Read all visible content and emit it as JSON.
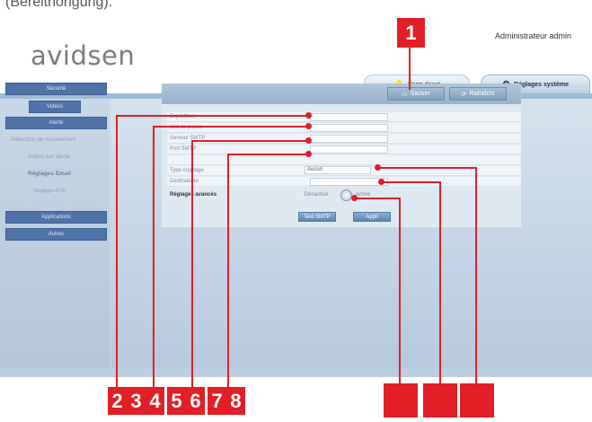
{
  "caption": "(Bereitnorigung).",
  "app": {
    "logo": "avidsen",
    "user": "Administrateur admin",
    "tabs": {
      "alert": "alarm deset",
      "system": "Réglages système"
    }
  },
  "sidebar": {
    "items": [
      {
        "label": "Sécurité",
        "style": "button"
      },
      {
        "label": "Vidéos",
        "style": "button-small"
      },
      {
        "label": "Alerté",
        "style": "button"
      },
      {
        "label": "Détection de mouvement",
        "style": "text"
      },
      {
        "label": "Action sur alerte",
        "style": "text"
      },
      {
        "label": "Réglages Email",
        "style": "text-bold"
      },
      {
        "label": "Réglages FTP",
        "style": "text-small"
      },
      {
        "label": "Applications",
        "style": "button"
      },
      {
        "label": "Autres",
        "style": "button"
      }
    ]
  },
  "header_buttons": {
    "save": "Sauver",
    "refresh": "Rafraîchi"
  },
  "form": {
    "rows": [
      {
        "label": "Expéditeur"
      },
      {
        "label": "Mot de passe"
      },
      {
        "label": "Serveur SMTP"
      },
      {
        "label": "Port SMTP"
      },
      {
        "label": "Type cryptage",
        "value": "Aucun"
      },
      {
        "label": "Destinataire"
      },
      {
        "label": "Réglages avancés",
        "value": "Désactivé"
      }
    ],
    "adv_right": "Activé",
    "test_button": "Test SMTP",
    "apply_button": "Appli"
  },
  "callouts": {
    "top": "1",
    "bottom": [
      "2",
      "3",
      "4",
      "5",
      "6",
      "7",
      "8"
    ]
  },
  "colors": {
    "callout": "#e21f26",
    "sidebar_button": "#4f73a8",
    "panel": "#dfe9f2"
  }
}
